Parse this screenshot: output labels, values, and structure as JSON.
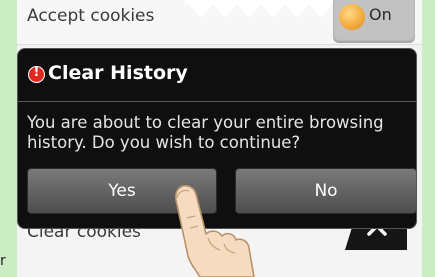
{
  "settings": {
    "accept_cookies_label": "Accept cookies",
    "accept_cookies_toggle": "On",
    "clear_cookies_label": "Clear cookies"
  },
  "dialog": {
    "title": "Clear History",
    "message": "You are about to clear your entire browsing history. Do you wish to continue?",
    "yes_label": "Yes",
    "no_label": "No"
  },
  "side_text": "r",
  "colors": {
    "background": "#ccecc4",
    "dialog_bg": "#0f0f0f",
    "alert_icon": "#e0281e",
    "toggle_knob": "#f3a83a"
  },
  "icons": {
    "alert": "alert-icon",
    "scroll_up": "chevron-up-icon",
    "touch": "finger-icon"
  }
}
